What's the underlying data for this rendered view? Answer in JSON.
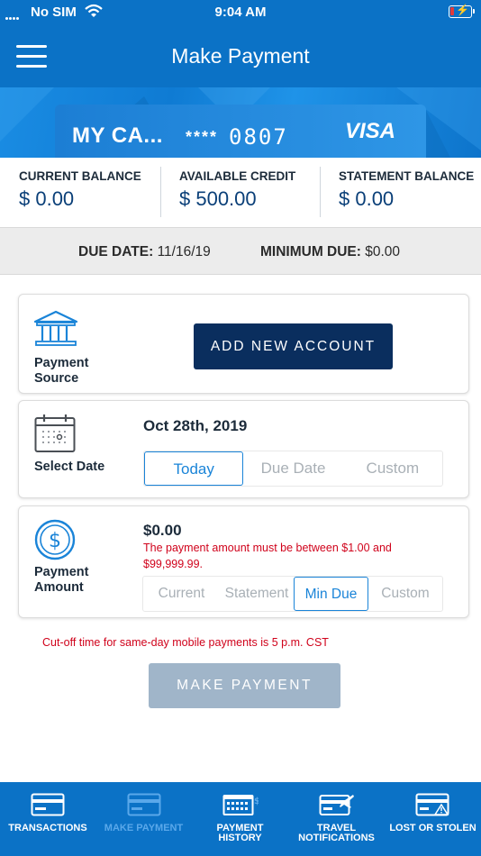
{
  "status_bar": {
    "carrier": "No SIM",
    "time": "9:04 AM",
    "battery_icon": "battery-charging-icon",
    "wifi_icon": "wifi-icon"
  },
  "header": {
    "title": "Make Payment",
    "menu_icon": "hamburger-menu-icon"
  },
  "card": {
    "name": "MY CA...",
    "masked": "****",
    "last4": "0807",
    "brand": "VISA"
  },
  "balances": [
    {
      "label": "CURRENT BALANCE",
      "value": "$ 0.00"
    },
    {
      "label": "AVAILABLE CREDIT",
      "value": "$ 500.00"
    },
    {
      "label": "STATEMENT BALANCE",
      "value": "$ 0.00"
    }
  ],
  "due": {
    "due_label": "DUE DATE:",
    "due_value": "11/16/19",
    "min_label": "MINIMUM DUE:",
    "min_value": "$0.00"
  },
  "payment_source": {
    "label_line1": "Payment",
    "label_line2": "Source",
    "icon": "bank-icon",
    "button": "ADD NEW ACCOUNT"
  },
  "select_date": {
    "label": "Select Date",
    "icon": "calendar-icon",
    "selected_date": "Oct 28th, 2019",
    "options": [
      "Today",
      "Due Date",
      "Custom"
    ],
    "active_index": 0
  },
  "payment_amount": {
    "label_line1": "Payment",
    "label_line2": "Amount",
    "icon": "dollar-circle-icon",
    "amount": "$0.00",
    "error_line1": "The payment amount must be between $1.00 and",
    "error_line2": "$99,999.99.",
    "options": [
      "Current",
      "Statement",
      "Min Due",
      "Custom"
    ],
    "active_index": 2
  },
  "cutoff_notice": "Cut-off time for same-day mobile payments is 5 p.m. CST",
  "make_payment_button": "MAKE PAYMENT",
  "tabs": [
    {
      "line1": "TRANSACTIONS",
      "line2": "",
      "icon": "card-icon",
      "active": false
    },
    {
      "line1": "MAKE PAYMENT",
      "line2": "",
      "icon": "card-icon",
      "active": true
    },
    {
      "line1": "PAYMENT",
      "line2": "HISTORY",
      "icon": "calendar-history-icon",
      "active": false
    },
    {
      "line1": "TRAVEL",
      "line2": "NOTIFICATIONS",
      "icon": "card-plane-icon",
      "active": false
    },
    {
      "line1": "LOST OR STOLEN",
      "line2": "",
      "icon": "card-alert-icon",
      "active": false
    }
  ],
  "colors": {
    "primary": "#0b72c6",
    "navy": "#0a2e5e",
    "accent": "#1a84d8",
    "error": "#d0021b",
    "disabled": "#a0b5c9"
  }
}
